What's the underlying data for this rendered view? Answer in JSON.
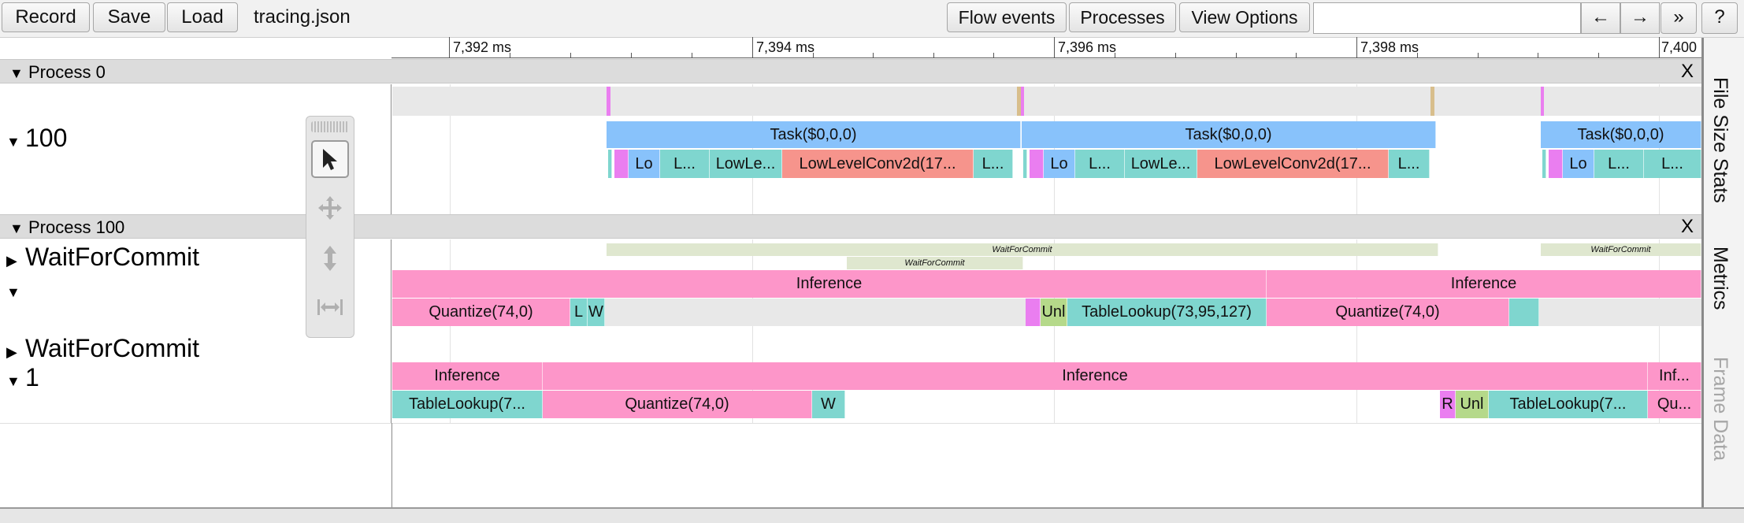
{
  "toolbar": {
    "record_label": "Record",
    "save_label": "Save",
    "load_label": "Load",
    "filename": "tracing.json",
    "flow_events_label": "Flow events",
    "processes_label": "Processes",
    "view_options_label": "View Options",
    "search_value": "",
    "prev_label": "←",
    "next_label": "→",
    "expand_label": "»",
    "help_label": "?"
  },
  "ruler": {
    "ticks": [
      "7,392 ms",
      "7,394 ms",
      "7,396 ms",
      "7,398 ms",
      "7,400"
    ]
  },
  "processes": [
    {
      "title": "Process 0",
      "close_label": "X",
      "thread_label": "100"
    },
    {
      "title": "Process 100",
      "close_label": "X",
      "rows": [
        "WaitForCommit",
        "",
        "WaitForCommit",
        "1"
      ]
    }
  ],
  "slices": {
    "task": "Task($0,0,0)",
    "lo": "Lo",
    "l_ellipsis": "L...",
    "lowle": "LowLe...",
    "lowlevelconv": "LowLevelConv2d(17...",
    "waitforcommit": "WaitForCommit",
    "inference": "Inference",
    "inference_short": "Inf...",
    "quantize": "Quantize(74,0)",
    "qu_short": "Qu...",
    "l": "L",
    "w": "W",
    "unl": "Unl",
    "r": "R",
    "tablelookup_full": "TableLookup(73,95,127)",
    "tablelookup_short": "TableLookup(7..."
  },
  "sidepanel": {
    "tabs": [
      "File Size Stats",
      "Metrics",
      "Frame Data"
    ]
  },
  "colors": {
    "task": "#88c2fb",
    "conv": "#f6948c",
    "teal": "#7fd6cf",
    "inference": "#fd96c9",
    "magenta": "#ea7ef0",
    "unl": "#b5d98a",
    "waitforcommit": "#dfe7cf"
  }
}
